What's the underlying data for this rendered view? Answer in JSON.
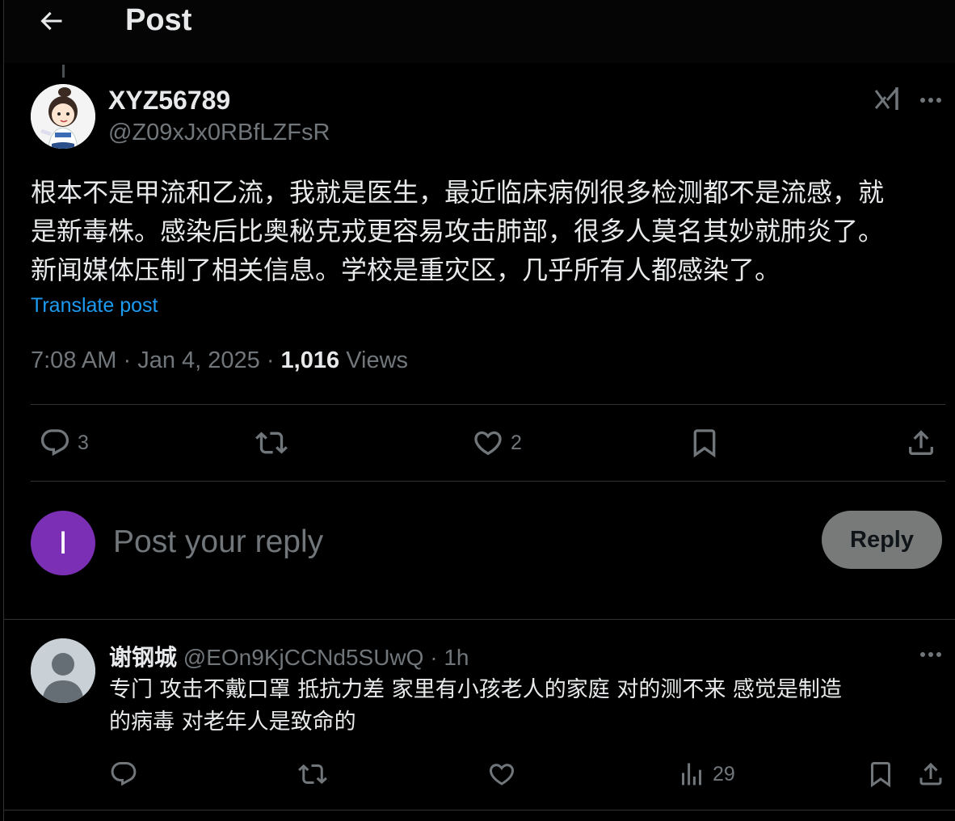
{
  "header": {
    "title": "Post"
  },
  "post": {
    "author_name": "XYZ56789",
    "author_handle": "@Z09xJx0RBfLZFsR",
    "text_lines": [
      "根本不是甲流和乙流，我就是医生，最近临床病例很多检测都不是流感，就",
      "是新毒株。感染后比奥秘克戎更容易攻击肺部，很多人莫名其妙就肺炎了。",
      "新闻媒体压制了相关信息。学校是重灾区，几乎所有人都感染了。"
    ],
    "translate_label": "Translate post",
    "time": "7:08 AM",
    "date": "Jan 4, 2025",
    "views_count": "1,016",
    "views_label": "Views",
    "actions": {
      "replies": "3",
      "likes": "2"
    }
  },
  "composer": {
    "avatar_initial": "I",
    "placeholder": "Post your reply",
    "reply_label": "Reply"
  },
  "comment": {
    "name": "谢钢城",
    "handle": "@EOn9KjCCNd5SUwQ",
    "time": "1h",
    "text_lines": [
      "专门 攻击不戴口罩 抵抗力差  家里有小孩老人的家庭  对的测不来  感觉是制造",
      "的病毒  对老年人是致命的"
    ],
    "views": "29"
  },
  "icons": {
    "back": "arrow-left-icon",
    "grok": "grok-icon",
    "more": "more-dots-icon",
    "reply": "comment-bubble-icon",
    "repost": "repost-icon",
    "like": "heart-icon",
    "bookmark": "bookmark-icon",
    "share": "share-icon",
    "views": "bar-chart-icon"
  },
  "colors": {
    "accent": "#1d9bf0",
    "avatar_user": "#7b2fb5",
    "muted": "#71767b",
    "background": "#000000"
  }
}
